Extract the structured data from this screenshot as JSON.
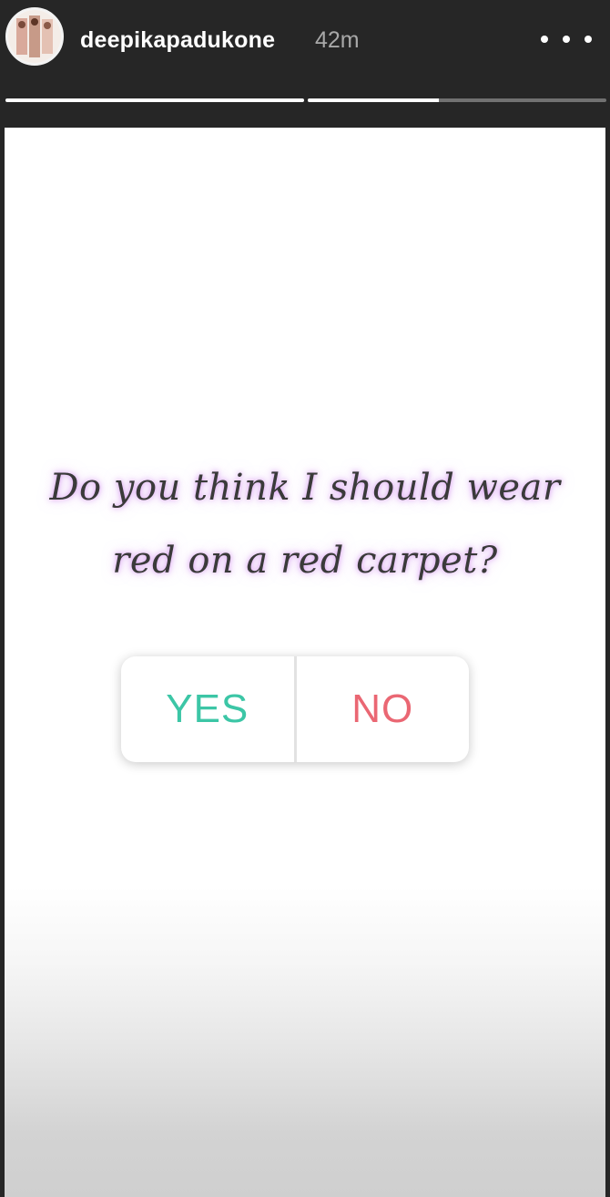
{
  "header": {
    "username": "deepikapadukone",
    "time_ago": "42m",
    "avatar_icon": "profile-photo-icon",
    "more_icon": "more-options-icon"
  },
  "progress": {
    "segments": [
      {
        "fill": 1.0
      },
      {
        "fill": 0.44
      }
    ]
  },
  "story": {
    "question_line1": "Do you think I should wear",
    "question_line2": "red on a red carpet?",
    "poll": {
      "option_yes": "YES",
      "option_no": "NO",
      "yes_color": "#3cc6a6",
      "no_color": "#ea6773"
    }
  },
  "colors": {
    "header_bg": "#262626",
    "text_glow": "#d28cf0"
  }
}
